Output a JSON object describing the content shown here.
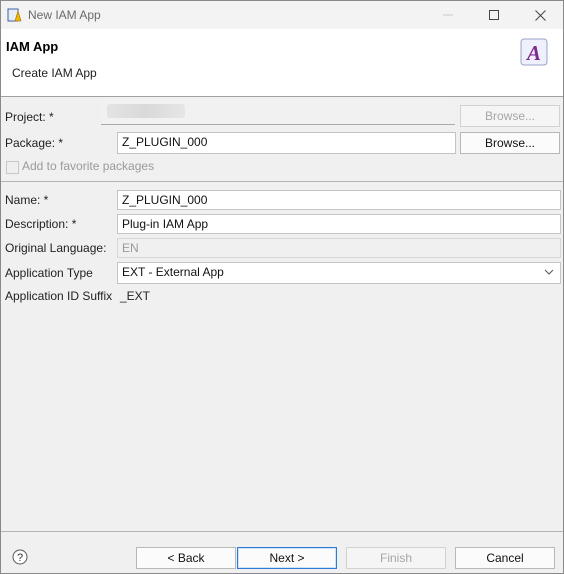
{
  "window": {
    "title": "New IAM App"
  },
  "header": {
    "title": "IAM App",
    "subtitle": "Create IAM App"
  },
  "form": {
    "project": {
      "label": "Project: *",
      "value": "",
      "browse_label": "Browse..."
    },
    "package": {
      "label": "Package: *",
      "value": "Z_PLUGIN_000",
      "browse_label": "Browse..."
    },
    "favorites": {
      "label": "Add to favorite packages",
      "checked": false
    },
    "name": {
      "label": "Name: *",
      "value": "Z_PLUGIN_000"
    },
    "description": {
      "label": "Description: *",
      "value": "Plug-in IAM App"
    },
    "original_language": {
      "label": "Original Language:",
      "value": "EN"
    },
    "application_type": {
      "label": "Application Type",
      "value": "EXT - External App"
    },
    "app_id_suffix": {
      "label": "Application ID Suffix",
      "value": "_EXT"
    }
  },
  "footer": {
    "back_label": "< Back",
    "next_label": "Next >",
    "finish_label": "Finish",
    "cancel_label": "Cancel"
  },
  "icons": {
    "app": "sap-adt-icon",
    "wizard": "abap-a-icon",
    "help": "help-icon"
  },
  "colors": {
    "accent": "#2a7ad6",
    "wizard_icon": "#7b2c8e"
  }
}
